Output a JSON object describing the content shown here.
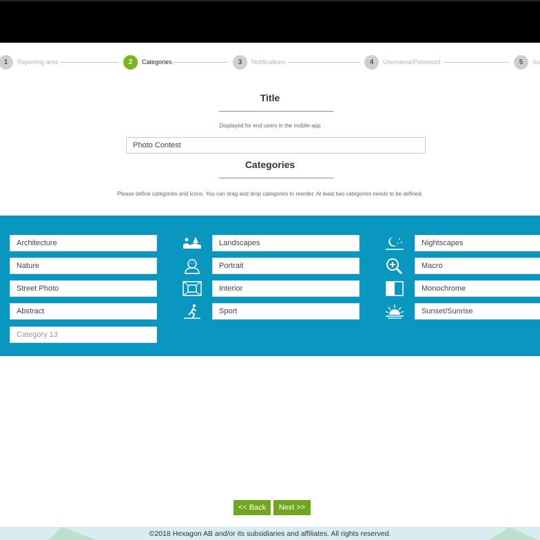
{
  "wizard": {
    "steps": [
      {
        "number": "1",
        "label": "Reporting area"
      },
      {
        "number": "2",
        "label": "Categories"
      },
      {
        "number": "3",
        "label": "Notifications"
      },
      {
        "number": "4",
        "label": "Username/Password"
      },
      {
        "number": "5",
        "label": "Su"
      }
    ],
    "active_step": 2
  },
  "title_section": {
    "heading": "Title",
    "hint": "Displayed for end users in the mobile app",
    "value": "Photo Contest"
  },
  "categories_section": {
    "heading": "Categories",
    "hint": "Please define categories and icons. You can drag and drop categories to reorder. At least two categories needs to be defined.",
    "items": [
      {
        "label": "Architecture",
        "icon": "none"
      },
      {
        "label": "Nature",
        "icon": "none"
      },
      {
        "label": "Street Photo",
        "icon": "none"
      },
      {
        "label": "Abstract",
        "icon": "none"
      },
      {
        "label": "Landscapes",
        "icon": "landscape-icon"
      },
      {
        "label": "Portrait",
        "icon": "portrait-icon"
      },
      {
        "label": "Interior",
        "icon": "interior-icon"
      },
      {
        "label": "Sport",
        "icon": "sport-icon"
      },
      {
        "label": "Nightscapes",
        "icon": "night-icon"
      },
      {
        "label": "Macro",
        "icon": "macro-icon"
      },
      {
        "label": "Monochrome",
        "icon": "monochrome-icon"
      },
      {
        "label": "Sunset/Sunrise",
        "icon": "sunset-icon"
      }
    ],
    "new_placeholder": "Category 13"
  },
  "buttons": {
    "back": "<< Back",
    "next": "Next >>"
  },
  "footer": {
    "text": "©2018 Hexagon AB and/or its subsidiaries and affiliates. All rights reserved."
  },
  "colors": {
    "accent_green": "#7ab51d",
    "band_blue": "#0a97bf",
    "button_green": "#6fa61e"
  }
}
